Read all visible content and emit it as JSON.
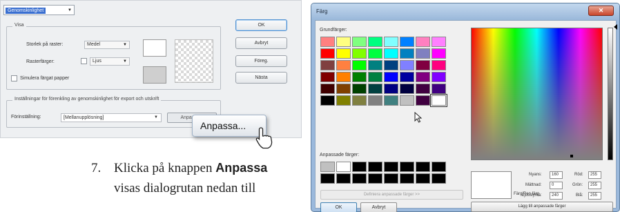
{
  "transparency_dialog": {
    "dropdown_value": "Genomskinlighet",
    "visa_legend": "Visa",
    "raster_size_label": "Storlek på raster:",
    "raster_size_value": "Medel",
    "raster_colors_label": "Rasterfärger:",
    "raster_colors_value": "Ljus",
    "simulate_paper_label": "Simulera färgat papper",
    "export_legend": "Inställningar för förenkling av genomskinlighet för export och utskrift",
    "preset_label": "Förinställning:",
    "preset_value": "[Mellanupplösning]",
    "customize_small_label": "Anpassa...",
    "buttons": {
      "ok": "OK",
      "cancel": "Avbryt",
      "previous": "Föreg.",
      "next": "Nästa"
    },
    "zoom_button_label": "Anpassa..."
  },
  "instruction": {
    "step_number": "7.",
    "line1_prefix": "Klicka på knappen ",
    "button_name": "Anpassa",
    "line2": "visas dialogrutan nedan till"
  },
  "color_dialog": {
    "title": "Färg",
    "close_symbol": "✕",
    "basic_colors_label": "Grundfärger:",
    "basic_colors": [
      "#ff8080",
      "#ffff80",
      "#80ff80",
      "#00ff80",
      "#80ffff",
      "#0080ff",
      "#ff80c0",
      "#ff80ff",
      "#ff0000",
      "#ffff00",
      "#80ff00",
      "#00ff40",
      "#00ffff",
      "#0080c0",
      "#8080c0",
      "#ff00ff",
      "#804040",
      "#ff8040",
      "#00ff00",
      "#008080",
      "#004080",
      "#8080ff",
      "#800040",
      "#ff0080",
      "#800000",
      "#ff8000",
      "#008000",
      "#008040",
      "#0000ff",
      "#0000a0",
      "#800080",
      "#8000ff",
      "#400000",
      "#804000",
      "#004000",
      "#004040",
      "#000080",
      "#000040",
      "#400040",
      "#400080",
      "#000000",
      "#808000",
      "#808040",
      "#808080",
      "#408080",
      "#c0c0c0",
      "#400040",
      "#ffffff"
    ],
    "custom_colors_label": "Anpassade färger:",
    "custom_colors": [
      "#c0c0c0",
      "#ffffff",
      "#000000",
      "#000000",
      "#000000",
      "#000000",
      "#000000",
      "#000000",
      "#000000",
      "#000000",
      "#000000",
      "#000000",
      "#000000",
      "#000000",
      "#000000",
      "#000000"
    ],
    "define_custom_label": "Definiera anpassade färger >>",
    "ok_label": "OK",
    "cancel_label": "Avbryt",
    "preview_label": "Färg|Ren färg",
    "fields": {
      "hue_label": "Nyans:",
      "hue_value": "160",
      "sat_label": "Mättnad:",
      "sat_value": "0",
      "lum_label": "Ljusstyrka:",
      "lum_value": "240",
      "red_label": "Röd:",
      "red_value": "255",
      "green_label": "Grön:",
      "green_value": "255",
      "blue_label": "Blå:",
      "blue_value": "255"
    },
    "add_custom_label": "Lägg till anpassade färger"
  }
}
